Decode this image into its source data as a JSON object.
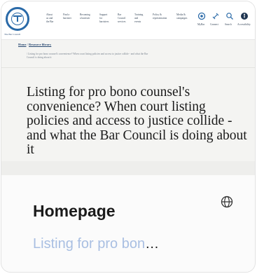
{
  "card": {
    "title": "Homepage",
    "subtitle": "Listing for pro bon",
    "subtitle_ellipsis": "…",
    "link_icon": "globe-icon",
    "subtitle_color": "#a9bfe2"
  },
  "site": {
    "logo_caption": "The Bar Council",
    "nav": [
      "About\nus and\nthe Bar",
      "Find a\nbarrister",
      "Becoming\na barrister",
      "Support\nfor\nbarristers",
      "Bar\nCouncil\nservices",
      "Training\nand\nevents",
      "Policy &\nrepresentation",
      "Media &\ncampaigns"
    ],
    "icon_nav": [
      {
        "icon": "mybar-icon",
        "label": "MyBar"
      },
      {
        "icon": "connect-icon",
        "label": "Connect"
      },
      {
        "icon": "search-icon",
        "label": "Search"
      },
      {
        "icon": "accessibility-icon",
        "label": "Accessibility"
      }
    ],
    "breadcrumb": {
      "home": "Home",
      "sep": "/",
      "current": "Resource library"
    },
    "sub_breadcrumb_line1": "/ Listing for pro bono counsel's convenience? When court listing policies and access to justice collide - and what the Bar",
    "sub_breadcrumb_line2": "Council is doing about it",
    "headline": "Listing for pro bono counsel's convenience? When court listing policies and access to justice collide - and what the Bar Council is doing about it",
    "brand_color": "#2a6aa8"
  }
}
